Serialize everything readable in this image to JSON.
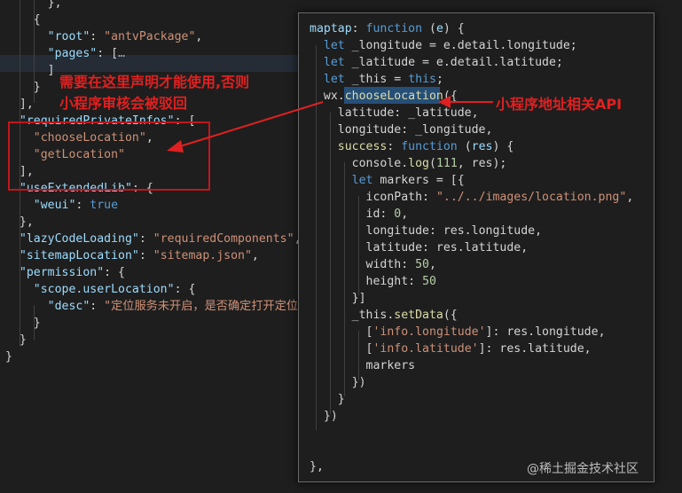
{
  "left_editor": {
    "lines": [
      {
        "indent": "      ",
        "tokens": [
          {
            "t": "},",
            "c": "w"
          }
        ]
      },
      {
        "indent": "    ",
        "tokens": [
          {
            "t": "{",
            "c": "w"
          }
        ]
      },
      {
        "indent": "      ",
        "tokens": [
          {
            "t": "\"root\"",
            "c": "p"
          },
          {
            "t": ": ",
            "c": "w"
          },
          {
            "t": "\"antvPackage\"",
            "c": "s"
          },
          {
            "t": ",",
            "c": "w"
          }
        ]
      },
      {
        "indent": "      ",
        "tokens": [
          {
            "t": "\"pages\"",
            "c": "p"
          },
          {
            "t": ": ",
            "c": "w"
          },
          {
            "t": "[",
            "c": "w"
          },
          {
            "t": "…",
            "c": "fold"
          }
        ]
      },
      {
        "indent": "      ",
        "tokens": [
          {
            "t": "]",
            "c": "w"
          }
        ]
      },
      {
        "indent": "    ",
        "tokens": [
          {
            "t": "}",
            "c": "w"
          }
        ]
      },
      {
        "indent": "  ",
        "tokens": [
          {
            "t": "],",
            "c": "w"
          }
        ]
      },
      {
        "indent": "  ",
        "tokens": [
          {
            "t": "\"requiredPrivateInfos\"",
            "c": "p"
          },
          {
            "t": ": [",
            "c": "w"
          }
        ]
      },
      {
        "indent": "    ",
        "tokens": [
          {
            "t": "\"chooseLocation\"",
            "c": "s"
          },
          {
            "t": ",",
            "c": "w"
          }
        ]
      },
      {
        "indent": "    ",
        "tokens": [
          {
            "t": "\"getLocation\"",
            "c": "s"
          }
        ]
      },
      {
        "indent": "  ",
        "tokens": [
          {
            "t": "],",
            "c": "w"
          }
        ]
      },
      {
        "indent": "  ",
        "tokens": [
          {
            "t": "\"useExtendedLib\"",
            "c": "p"
          },
          {
            "t": ": {",
            "c": "w"
          }
        ]
      },
      {
        "indent": "    ",
        "tokens": [
          {
            "t": "\"weui\"",
            "c": "p"
          },
          {
            "t": ": ",
            "c": "w"
          },
          {
            "t": "true",
            "c": "kb"
          }
        ]
      },
      {
        "indent": "  ",
        "tokens": [
          {
            "t": "},",
            "c": "w"
          }
        ]
      },
      {
        "indent": "  ",
        "tokens": [
          {
            "t": "\"lazyCodeLoading\"",
            "c": "p"
          },
          {
            "t": ": ",
            "c": "w"
          },
          {
            "t": "\"requiredComponents\"",
            "c": "s"
          },
          {
            "t": ",",
            "c": "w"
          }
        ]
      },
      {
        "indent": "  ",
        "tokens": [
          {
            "t": "\"sitemapLocation\"",
            "c": "p"
          },
          {
            "t": ": ",
            "c": "w"
          },
          {
            "t": "\"sitemap.json\"",
            "c": "s"
          },
          {
            "t": ",",
            "c": "w"
          }
        ]
      },
      {
        "indent": "  ",
        "tokens": [
          {
            "t": "\"permission\"",
            "c": "p"
          },
          {
            "t": ": {",
            "c": "w"
          }
        ]
      },
      {
        "indent": "    ",
        "tokens": [
          {
            "t": "\"scope.userLocation\"",
            "c": "p"
          },
          {
            "t": ": {",
            "c": "w"
          }
        ]
      },
      {
        "indent": "      ",
        "tokens": [
          {
            "t": "\"desc\"",
            "c": "p"
          },
          {
            "t": ": ",
            "c": "w"
          },
          {
            "t": "\"定位服务未开启，是否确定打开定位",
            "c": "s"
          }
        ]
      },
      {
        "indent": "    ",
        "tokens": [
          {
            "t": "}",
            "c": "w"
          }
        ]
      },
      {
        "indent": "  ",
        "tokens": [
          {
            "t": "}",
            "c": "w"
          }
        ]
      },
      {
        "indent": "",
        "tokens": [
          {
            "t": "}",
            "c": "w"
          }
        ]
      }
    ]
  },
  "right_editor": {
    "lines": [
      {
        "indent": "",
        "tokens": [
          {
            "t": "maptap",
            "c": "p"
          },
          {
            "t": ": ",
            "c": "w"
          },
          {
            "t": "function",
            "c": "kb"
          },
          {
            "t": " (",
            "c": "w"
          },
          {
            "t": "e",
            "c": "p"
          },
          {
            "t": ") {",
            "c": "w"
          }
        ]
      },
      {
        "indent": "  ",
        "tokens": [
          {
            "t": "let",
            "c": "kb"
          },
          {
            "t": " _longitude = e.detail.longitude;",
            "c": "w"
          }
        ]
      },
      {
        "indent": "  ",
        "tokens": [
          {
            "t": "let",
            "c": "kb"
          },
          {
            "t": " _latitude = e.detail.latitude;",
            "c": "w"
          }
        ]
      },
      {
        "indent": "  ",
        "tokens": [
          {
            "t": "let",
            "c": "kb"
          },
          {
            "t": " _this = ",
            "c": "w"
          },
          {
            "t": "this",
            "c": "kb"
          },
          {
            "t": ";",
            "c": "w"
          }
        ]
      },
      {
        "indent": "  ",
        "tokens": [
          {
            "t": "wx.",
            "c": "w"
          },
          {
            "t": "chooseLocation",
            "c": "f"
          },
          {
            "t": "({",
            "c": "w"
          }
        ]
      },
      {
        "indent": "    ",
        "tokens": [
          {
            "t": "latitude: _latitude,",
            "c": "w"
          }
        ]
      },
      {
        "indent": "    ",
        "tokens": [
          {
            "t": "longitude: _longitude,",
            "c": "w"
          }
        ]
      },
      {
        "indent": "    ",
        "tokens": [
          {
            "t": "success",
            "c": "f"
          },
          {
            "t": ": ",
            "c": "w"
          },
          {
            "t": "function",
            "c": "kb"
          },
          {
            "t": " (",
            "c": "w"
          },
          {
            "t": "res",
            "c": "p"
          },
          {
            "t": ") {",
            "c": "w"
          }
        ]
      },
      {
        "indent": "      ",
        "tokens": [
          {
            "t": "console.",
            "c": "w"
          },
          {
            "t": "log",
            "c": "f"
          },
          {
            "t": "(",
            "c": "w"
          },
          {
            "t": "111",
            "c": "n"
          },
          {
            "t": ", res);",
            "c": "w"
          }
        ]
      },
      {
        "indent": "      ",
        "tokens": [
          {
            "t": "let",
            "c": "kb"
          },
          {
            "t": " markers = [{",
            "c": "w"
          }
        ]
      },
      {
        "indent": "        ",
        "tokens": [
          {
            "t": "iconPath: ",
            "c": "w"
          },
          {
            "t": "\"../../images/location.png\"",
            "c": "s"
          },
          {
            "t": ",",
            "c": "w"
          }
        ]
      },
      {
        "indent": "        ",
        "tokens": [
          {
            "t": "id: ",
            "c": "w"
          },
          {
            "t": "0",
            "c": "n"
          },
          {
            "t": ",",
            "c": "w"
          }
        ]
      },
      {
        "indent": "        ",
        "tokens": [
          {
            "t": "longitude: res.longitude,",
            "c": "w"
          }
        ]
      },
      {
        "indent": "        ",
        "tokens": [
          {
            "t": "latitude: res.latitude,",
            "c": "w"
          }
        ]
      },
      {
        "indent": "        ",
        "tokens": [
          {
            "t": "width: ",
            "c": "w"
          },
          {
            "t": "50",
            "c": "n"
          },
          {
            "t": ",",
            "c": "w"
          }
        ]
      },
      {
        "indent": "        ",
        "tokens": [
          {
            "t": "height: ",
            "c": "w"
          },
          {
            "t": "50",
            "c": "n"
          }
        ]
      },
      {
        "indent": "      ",
        "tokens": [
          {
            "t": "}]",
            "c": "w"
          }
        ]
      },
      {
        "indent": "      ",
        "tokens": [
          {
            "t": "_this.",
            "c": "w"
          },
          {
            "t": "setData",
            "c": "f"
          },
          {
            "t": "({",
            "c": "w"
          }
        ]
      },
      {
        "indent": "        ",
        "tokens": [
          {
            "t": "[",
            "c": "w"
          },
          {
            "t": "'info.longitude'",
            "c": "s"
          },
          {
            "t": "]: res.longitude,",
            "c": "w"
          }
        ]
      },
      {
        "indent": "        ",
        "tokens": [
          {
            "t": "[",
            "c": "w"
          },
          {
            "t": "'info.latitude'",
            "c": "s"
          },
          {
            "t": "]: res.latitude,",
            "c": "w"
          }
        ]
      },
      {
        "indent": "        ",
        "tokens": [
          {
            "t": "markers",
            "c": "w"
          }
        ]
      },
      {
        "indent": "      ",
        "tokens": [
          {
            "t": "})",
            "c": "w"
          }
        ]
      },
      {
        "indent": "    ",
        "tokens": [
          {
            "t": "}",
            "c": "w"
          }
        ]
      },
      {
        "indent": "  ",
        "tokens": [
          {
            "t": "})",
            "c": "w"
          }
        ]
      },
      {
        "indent": "",
        "tokens": []
      },
      {
        "indent": "",
        "tokens": []
      },
      {
        "indent": "",
        "tokens": [
          {
            "t": "},",
            "c": "w"
          }
        ]
      }
    ]
  },
  "annotations": {
    "left_note_line1": "需要在这里声明才能使用,否则",
    "left_note_line2": "小程序审核会被驳回",
    "right_note": "小程序地址相关API"
  },
  "watermark": "@稀土掘金技术社区",
  "colors": {
    "annotation": "#e02020",
    "background": "#1e1e1e"
  }
}
